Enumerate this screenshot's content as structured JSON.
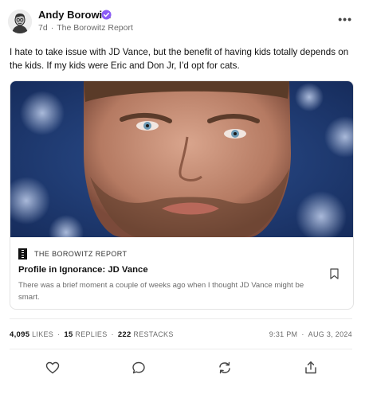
{
  "author": {
    "name": "Andy Borowitz",
    "age": "7d",
    "publication": "The Borowitz Report"
  },
  "post": {
    "text": "I hate to take issue with JD Vance, but the benefit of having kids totally depends on the kids. If my kids were Eric and Don Jr, I’d opt for cats."
  },
  "embed": {
    "publication": "THE BOROWITZ REPORT",
    "title": "Profile in Ignorance: JD Vance",
    "subtitle": "There was a brief moment a couple of weeks ago when I thought JD Vance might be smart."
  },
  "stats": {
    "likes_count": "4,095",
    "likes_label": "LIKES",
    "replies_count": "15",
    "replies_label": "REPLIES",
    "restacks_count": "222",
    "restacks_label": "RESTACKS",
    "time": "9:31 PM",
    "date": "AUG 3, 2024"
  },
  "icons": {
    "more": "more-icon",
    "verified": "verified-badge-icon",
    "bookmark": "bookmark-icon",
    "like": "heart-icon",
    "reply": "comment-icon",
    "restack": "restack-icon",
    "share": "share-icon"
  },
  "colors": {
    "verified": "#8b5cf6",
    "muted_text": "#6b6b6b",
    "image_background": "#1e3a6e"
  }
}
